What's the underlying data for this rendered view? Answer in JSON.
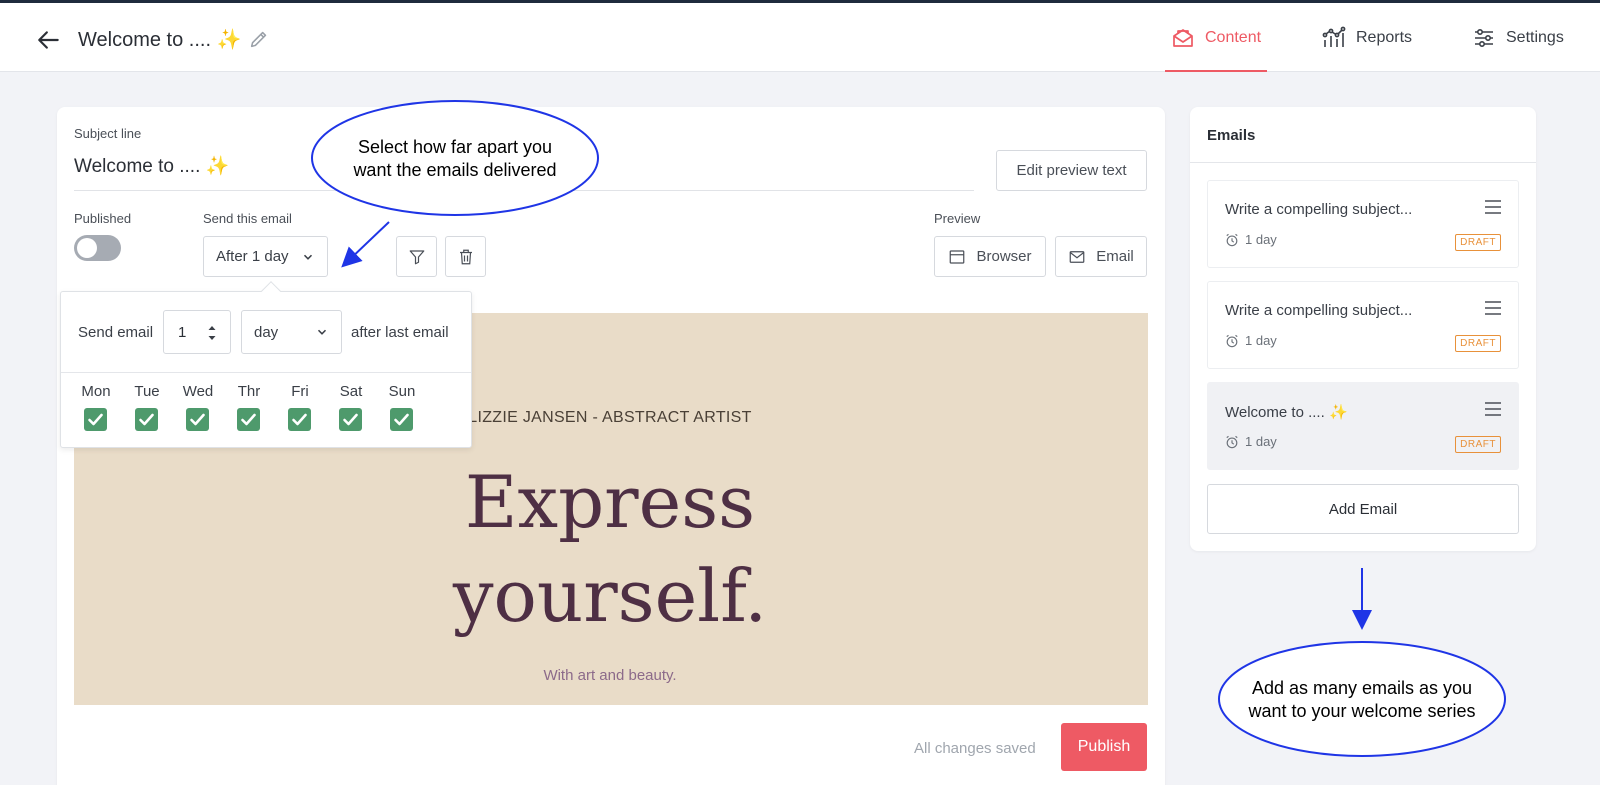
{
  "header": {
    "title": "Welcome to ....",
    "title_emoji": "✨",
    "tabs": [
      {
        "label": "Content",
        "icon": "envelope-icon",
        "active": true
      },
      {
        "label": "Reports",
        "icon": "line-chart-icon",
        "active": false
      },
      {
        "label": "Settings",
        "icon": "sliders-icon",
        "active": false
      }
    ]
  },
  "editor": {
    "subject_label": "Subject line",
    "subject_value": "Welcome to ....",
    "subject_emoji": "✨",
    "edit_preview_label": "Edit preview text",
    "published_label": "Published",
    "published": false,
    "send_label": "Send this email",
    "send_value": "After 1 day",
    "preview_label": "Preview",
    "preview_browser": "Browser",
    "preview_email": "Email"
  },
  "schedule_popover": {
    "send_email_label": "Send email",
    "amount": "1",
    "unit": "day",
    "after_label": "after last email",
    "days": [
      {
        "label": "Mon",
        "checked": true
      },
      {
        "label": "Tue",
        "checked": true
      },
      {
        "label": "Wed",
        "checked": true
      },
      {
        "label": "Thr",
        "checked": true
      },
      {
        "label": "Fri",
        "checked": true
      },
      {
        "label": "Sat",
        "checked": true
      },
      {
        "label": "Sun",
        "checked": true
      }
    ]
  },
  "email_preview": {
    "artist": "LIZZIE JANSEN - ABSTRACT ARTIST",
    "headline_line1": "Express",
    "headline_line2": "yourself.",
    "tagline": "With art and beauty.",
    "background": "#e9dcc8"
  },
  "footer": {
    "status": "All changes saved",
    "publish_label": "Publish"
  },
  "emails_panel": {
    "title": "Emails",
    "items": [
      {
        "subject": "Write a compelling subject...",
        "delay": "1 day",
        "badge": "DRAFT"
      },
      {
        "subject": "Write a compelling subject...",
        "delay": "1 day",
        "badge": "DRAFT"
      },
      {
        "subject": "Welcome to ....",
        "emoji": "✨",
        "delay": "1 day",
        "badge": "DRAFT"
      }
    ],
    "add_label": "Add Email"
  },
  "annotations": {
    "callout_top_line1": "Select how far apart you",
    "callout_top_line2": "want the emails delivered",
    "callout_bottom_line1": "Add as many emails as you",
    "callout_bottom_line2": "want to your welcome series"
  },
  "colors": {
    "accent": "#ee5a64",
    "check_green": "#4e9a6c",
    "draft_orange": "#e8913a",
    "annotation_blue": "#1f35e6"
  }
}
